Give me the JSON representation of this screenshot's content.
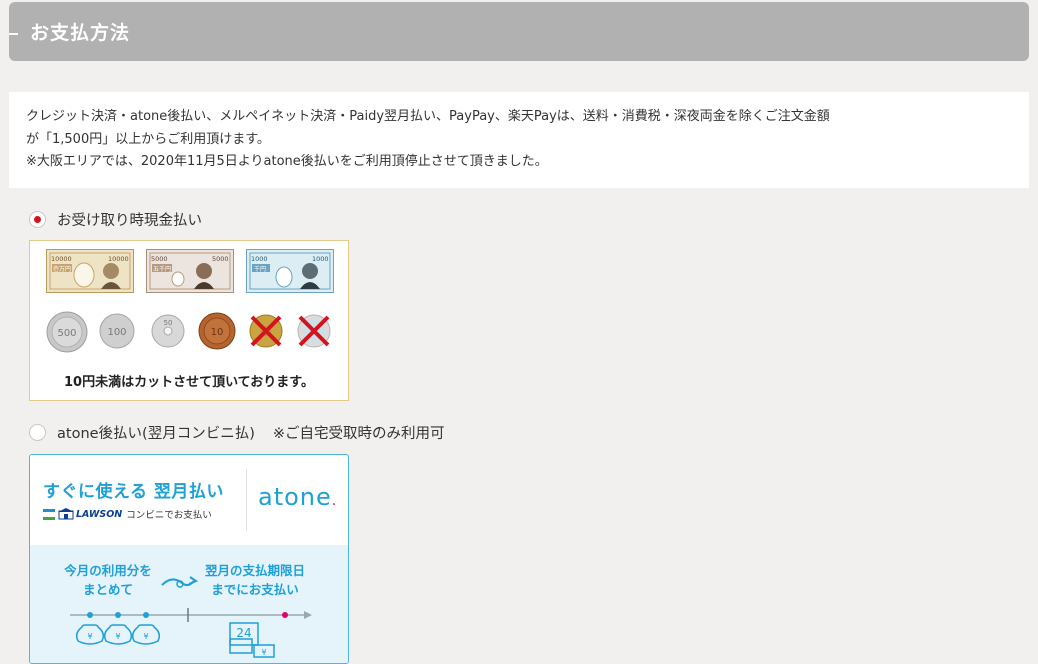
{
  "section": {
    "title": "お支払方法"
  },
  "notice": {
    "line1": "クレジット決済・atone後払い、メルペイネット決済・Paidy翌月払い、PayPay、楽天Payは、送料・消費税・深夜両金を除くご注文金額",
    "line2": "が「1,500円」以上からご利用頂けます。",
    "line3": "※大阪エリアでは、2020年11月5日よりatone後払いをご利用頂停止させて頂きました。"
  },
  "payment_options": [
    {
      "label": "お受け取り時現金払い",
      "selected": true
    },
    {
      "label": "atone後払い(翌月コンビニ払)",
      "note": "※ご自宅受取時のみ利用可",
      "selected": false
    }
  ],
  "cash_panel": {
    "bills": [
      {
        "value": "10000",
        "kanji": "壱万円",
        "color": "#c9a469"
      },
      {
        "value": "5000",
        "kanji": "五千円",
        "color": "#b79a7e"
      },
      {
        "value": "1000",
        "kanji": "千円",
        "color": "#6aa4c2"
      }
    ],
    "coins": [
      {
        "value": "500",
        "color": "#c8c8c8",
        "accepted": true
      },
      {
        "value": "100",
        "color": "#cfcfcf",
        "accepted": true
      },
      {
        "value": "50",
        "color": "#d8d8d8",
        "accepted": true
      },
      {
        "value": "10",
        "color": "#b5642e",
        "accepted": true
      },
      {
        "value": "5",
        "color": "#c9a440",
        "accepted": false
      },
      {
        "value": "1",
        "color": "#dcdcdc",
        "accepted": false
      }
    ],
    "caption": "10円未満はカットさせて頂いております。"
  },
  "atone_panel": {
    "headline": "すぐに使える 翌月払い",
    "lawson_brand": "LAWSON",
    "lawson_text": "コンビニでお支払い",
    "logo": "atone",
    "step1": "今月の利用分を まとめて",
    "step2": "翌月の支払期限日 までにお支払い",
    "calendar_day": "24",
    "yen": "¥",
    "colors": {
      "accent": "#1fa0d6",
      "pink": "#e5006e"
    }
  }
}
